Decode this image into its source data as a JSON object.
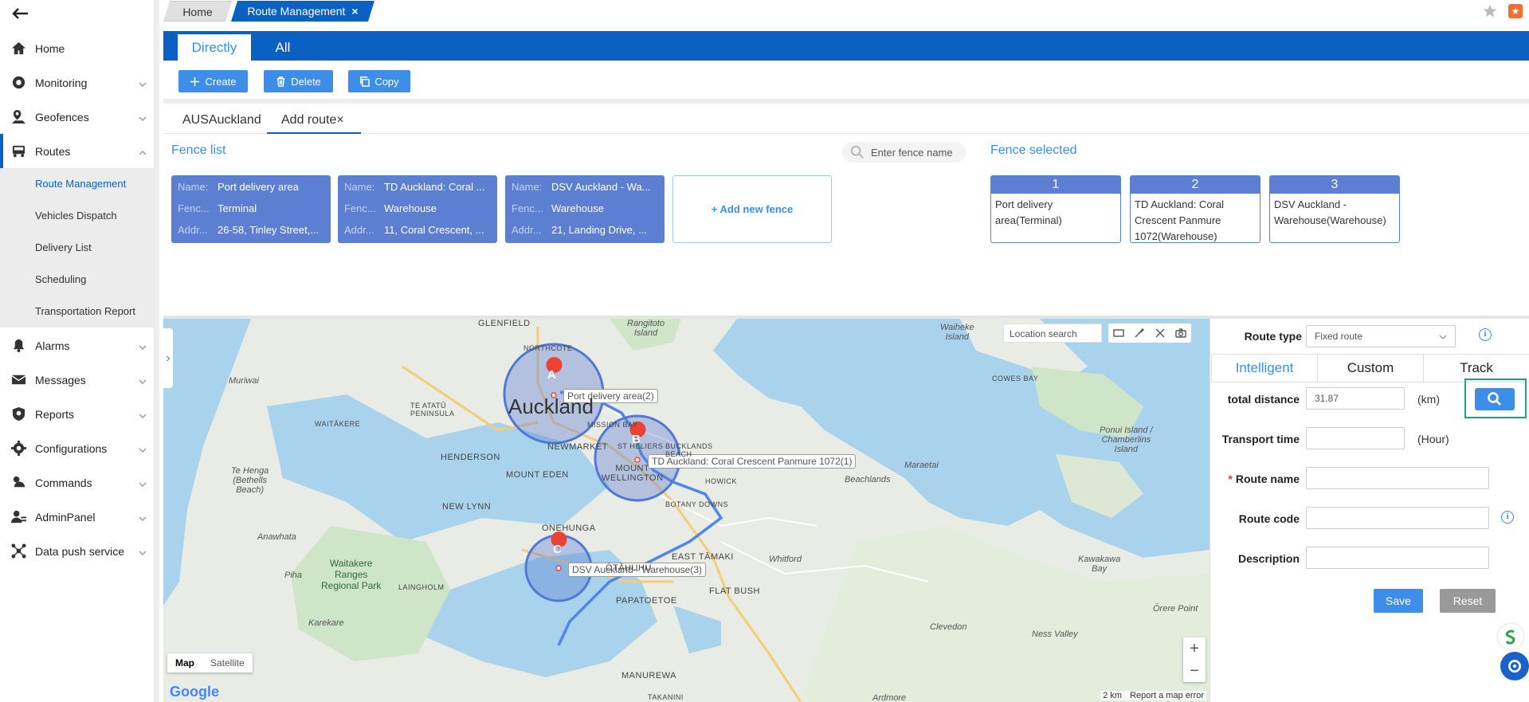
{
  "sidebar": {
    "items": [
      {
        "label": "Home",
        "icon": "home-icon"
      },
      {
        "label": "Monitoring",
        "icon": "monitor-icon"
      },
      {
        "label": "Geofences",
        "icon": "geofence-icon"
      },
      {
        "label": "Routes",
        "icon": "route-icon"
      },
      {
        "label": "Alarms",
        "icon": "alarm-icon"
      },
      {
        "label": "Messages",
        "icon": "message-icon"
      },
      {
        "label": "Reports",
        "icon": "report-icon"
      },
      {
        "label": "Configurations",
        "icon": "config-icon"
      },
      {
        "label": "Commands",
        "icon": "command-icon"
      },
      {
        "label": "AdminPanel",
        "icon": "admin-icon"
      },
      {
        "label": "Data push service",
        "icon": "data-push-icon"
      }
    ],
    "routes_submenu": [
      "Route Management",
      "Vehicles Dispatch",
      "Delivery List",
      "Scheduling",
      "Transportation Report"
    ]
  },
  "page_tabs": {
    "home": "Home",
    "current": "Route Management",
    "close": "×"
  },
  "header_tabs": {
    "directly": "Directly",
    "all": "All"
  },
  "toolbar": {
    "create": "Create",
    "delete": "Delete",
    "copy": "Copy"
  },
  "sub_tabs": {
    "aus": "AUSAuckland",
    "add_route": "Add route×"
  },
  "fence": {
    "list_title": "Fence list",
    "selected_title": "Fence selected",
    "search_placeholder": "Enter fence name",
    "key_name": "Name:",
    "key_type": "Fenc...",
    "key_addr": "Addr...",
    "cards": [
      {
        "name": "Port delivery area",
        "type": "Terminal",
        "addr": "26-58, Tinley Street,..."
      },
      {
        "name": "TD Auckland: Coral ...",
        "type": "Warehouse",
        "addr": "11, Coral Crescent, ..."
      },
      {
        "name": "DSV Auckland - Wa...",
        "type": "Warehouse",
        "addr": "21, Landing Drive, ..."
      }
    ],
    "add_new": "+ Add new fence",
    "selected": [
      {
        "num": "1",
        "text": "Port delivery area(Terminal)"
      },
      {
        "num": "2",
        "text": "TD Auckland: Coral Crescent Panmure 1072(Warehouse)"
      },
      {
        "num": "3",
        "text": "DSV Auckland - Warehouse(Warehouse)"
      }
    ]
  },
  "map": {
    "location_search": "Location search",
    "type_map": "Map",
    "type_satellite": "Satellite",
    "zoom_in": "+",
    "zoom_out": "−",
    "google": "Google",
    "scale": "2 km",
    "report": "Report a map error",
    "markers": [
      {
        "letter": "A",
        "label": "Port delivery area(2)"
      },
      {
        "letter": "B",
        "label": "TD Auckland: Coral Crescent Panmure 1072(1)"
      },
      {
        "letter": "C",
        "label": "DSV Auckland - Warehouse(3)"
      }
    ],
    "places": {
      "auckland": "Auckland",
      "glenfield": "GLENFIELD",
      "northcote": "NORTHCOTE",
      "muriwai": "Muriwai",
      "te_atatu": "TE ATATŪ\nPENINSULA",
      "waitakere": "WAITĀKERE",
      "henderson": "HENDERSON",
      "newmarket": "NEWMARKET",
      "mission_bay": "MISSION BAY",
      "st_heliers": "ST HELIERS",
      "bucklands": "BUCKLANDS\nBEACH",
      "mount_eden": "MOUNT EDEN",
      "mount_wellington": "MOUNT\nWELLINGTON",
      "howick": "HOWICK",
      "botany": "BOTANY DOWNS",
      "new_lynn": "NEW LYNN",
      "onehunga": "ONEHUNGA",
      "te_henga": "Te Henga\n(Bethells\nBeach)",
      "anawhata": "Anawhata",
      "piha": "Piha",
      "waitakere_ranges": "Waitakere\nRanges\nRegional Park",
      "laingholm": "LAINGHOLM",
      "karekare": "Karekare",
      "otahuhu": "ŌTĀHUHU",
      "east_tamaki": "EAST TĀMAKI",
      "flat_bush": "FLAT BUSH",
      "papatoetoe": "PAPATOETOE",
      "whitford": "Whitford",
      "clevedon": "Clevedon",
      "manurewa": "MANUREWA",
      "takanini": "TAKANINI",
      "ardmore": "Ardmore",
      "rangitoto": "Rangitoto\nIsland",
      "waiheke": "Waiheke\nIsland",
      "cowes_bay": "COWES BAY",
      "ponui": "Ponui Island /\nChamberlins\nIsland",
      "maraetai": "Maraetai",
      "beachlands": "Beachlands",
      "kawakawa": "Kawakawa\nBay",
      "orere": "Ōrere Point",
      "ness_valley": "Ness Valley"
    }
  },
  "form": {
    "route_type_label": "Route type",
    "route_type_value": "Fixed route",
    "tabs": [
      "Intelligent",
      "Custom",
      "Track"
    ],
    "total_distance_label": "total distance",
    "total_distance_value": "31.87",
    "km": "(km)",
    "transport_time_label": "Transport time",
    "hour": "(Hour)",
    "required": "*",
    "route_name_label": "Route name",
    "route_code_label": "Route code",
    "description_label": "Description",
    "info": "i",
    "save": "Save",
    "reset": "Reset"
  },
  "colors": {
    "primary": "#0a61c2",
    "button": "#3d8ee8",
    "fence_card": "#5c7fd1",
    "highlight": "#22a380"
  }
}
